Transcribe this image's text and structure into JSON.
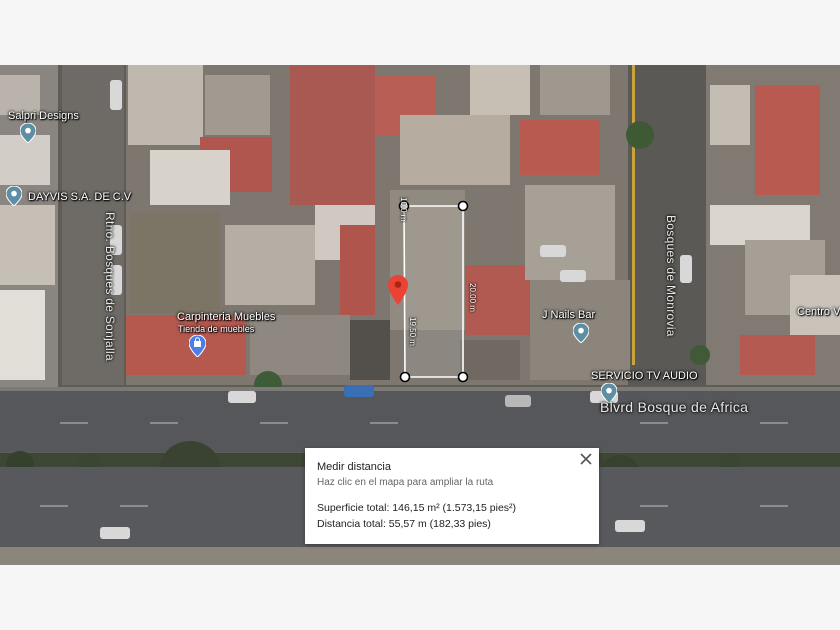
{
  "map": {
    "pois": [
      {
        "id": "salpri",
        "label": "Salpri Designs"
      },
      {
        "id": "dayvis",
        "label": "DAYVIS S.A. DE C.V"
      },
      {
        "id": "carpinteria",
        "label": "Carpinteria Muebles",
        "sublabel": "Tienda de muebles"
      },
      {
        "id": "jnails",
        "label": "J Nails Bar"
      },
      {
        "id": "servicio",
        "label": "SERVICIO TV AUDIO"
      },
      {
        "id": "centro",
        "label": "Centro V"
      }
    ],
    "streets": {
      "sonjalla": "Rtno. Bosques de Sonjalla",
      "monrovia": "Bosques de Monrovia",
      "africa": "Blvrd Bosque de Africa"
    },
    "measure": {
      "top": "10.0 m",
      "right": "20.00 m",
      "left": "19.50 m"
    },
    "colors": {
      "pin": "#ea4335",
      "poi_icon": "#5e8ea3",
      "shop_icon": "#4e7de8"
    }
  },
  "panel": {
    "title": "Medir distancia",
    "hint": "Haz clic en el mapa para ampliar la ruta",
    "area": "Superficie total: 146,15 m² (1.573,15 pies²)",
    "distance": "Distancia total: 55,57 m (182,33 pies)",
    "close_icon": "close-icon"
  }
}
